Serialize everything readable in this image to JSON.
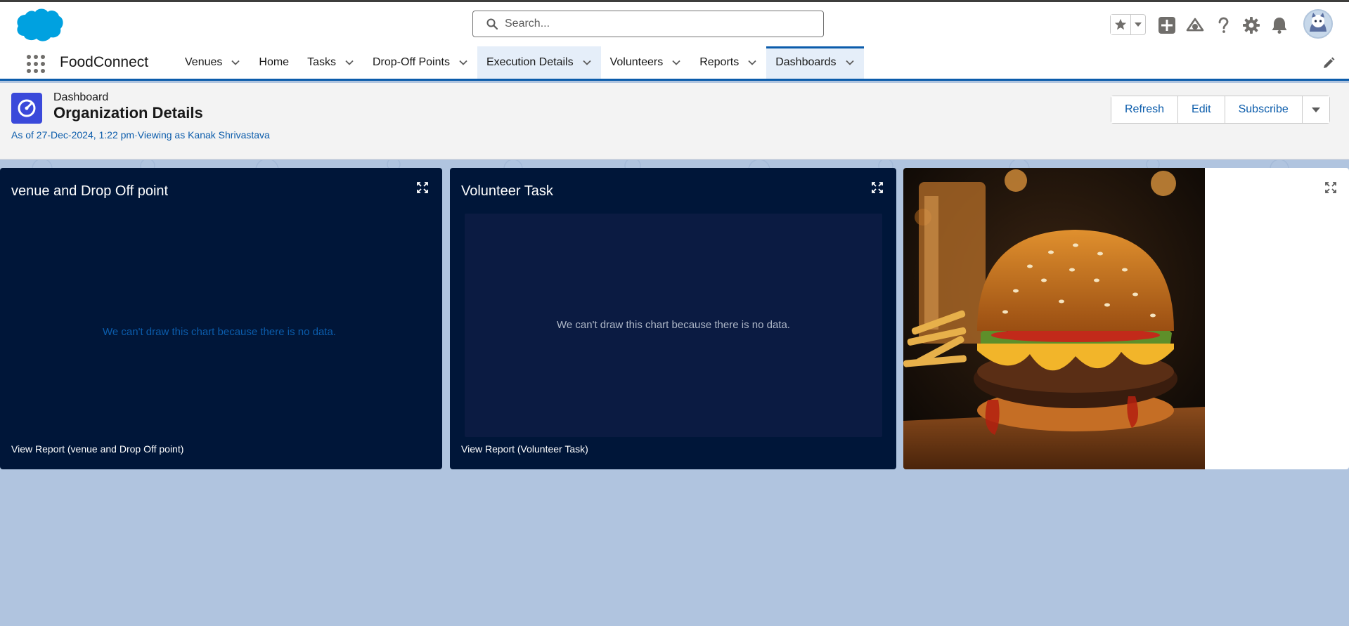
{
  "header": {
    "search_placeholder": "Search...",
    "icons": [
      "salesforce-cloud-logo",
      "star-icon",
      "chevron-down-icon",
      "plus-icon",
      "trailhead-icon",
      "question-icon",
      "gear-icon",
      "bell-icon",
      "avatar"
    ]
  },
  "nav": {
    "app_name": "FoodConnect",
    "items": [
      {
        "label": "Venues",
        "has_menu": true
      },
      {
        "label": "Home",
        "has_menu": false
      },
      {
        "label": "Tasks",
        "has_menu": true
      },
      {
        "label": "Drop-Off Points",
        "has_menu": true
      },
      {
        "label": "Execution Details",
        "has_menu": true
      },
      {
        "label": "Volunteers",
        "has_menu": true
      },
      {
        "label": "Reports",
        "has_menu": true
      },
      {
        "label": "Dashboards",
        "has_menu": true
      }
    ],
    "active": "Dashboards"
  },
  "dashboard": {
    "label": "Dashboard",
    "title": "Organization Details",
    "meta": "As of 27-Dec-2024, 1:22 pm·Viewing as Kanak Shrivastava",
    "buttons": {
      "refresh": "Refresh",
      "edit": "Edit",
      "subscribe": "Subscribe"
    }
  },
  "widgets": [
    {
      "title": "venue and Drop Off point",
      "message": "We can't draw this chart because there is no data.",
      "link": "View Report (venue and Drop Off point)"
    },
    {
      "title": "Volunteer Task",
      "message": "We can't draw this chart because there is no data.",
      "link": "View Report (Volunteer Task)"
    },
    {
      "title": "",
      "image": "burger-image"
    }
  ],
  "colors": {
    "brand_blue": "#0b5cab",
    "widget_bg": "#001639",
    "canvas_bg": "#b0c4df",
    "dashboard_icon": "#3a49da"
  }
}
